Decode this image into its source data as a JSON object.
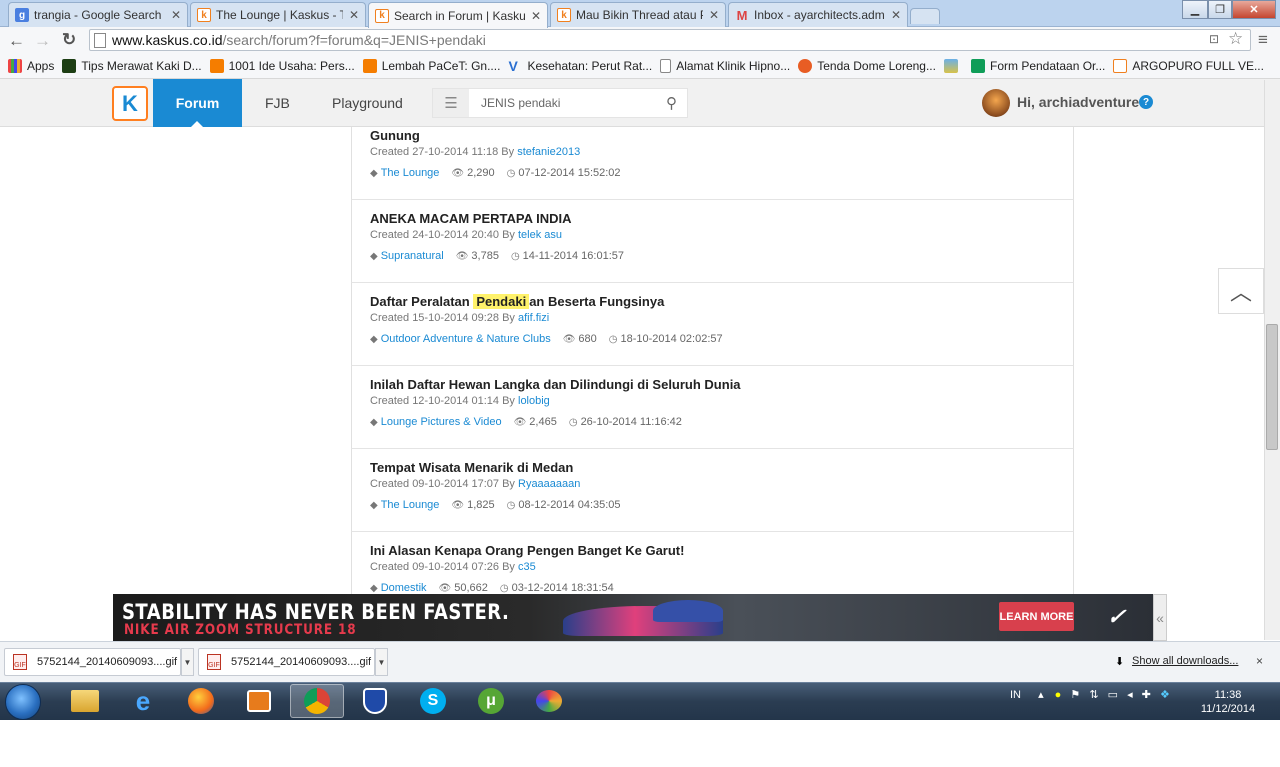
{
  "browser": {
    "tabs": [
      {
        "title": "trangia - Google Search",
        "icon": "google-icon",
        "color": "#4a7fe0"
      },
      {
        "title": "The Lounge | Kaskus - The",
        "icon": "kaskus-icon",
        "color": "#f0801f"
      },
      {
        "title": "Search in Forum | Kaskus",
        "icon": "kaskus-icon",
        "color": "#f0801f"
      },
      {
        "title": "Mau Bikin Thread atau Po",
        "icon": "kaskus-icon",
        "color": "#f0801f"
      },
      {
        "title": "Inbox - ayarchitects.adm",
        "icon": "gmail-icon",
        "color": "#d44"
      }
    ],
    "url_host": "www.kaskus.co.id",
    "url_path": "/search/forum?f=forum&q=JENIS+pendaki",
    "bookmarks": [
      {
        "label": "Apps",
        "icon": "apps-icon"
      },
      {
        "label": "Tips Merawat Kaki D...",
        "icon": "page-icon"
      },
      {
        "label": "1001 Ide Usaha: Pers...",
        "icon": "blogger-icon"
      },
      {
        "label": "Lembah PaCeT: Gn....",
        "icon": "blogger-icon"
      },
      {
        "label": "Kesehatan: Perut Rat...",
        "icon": "v-icon"
      },
      {
        "label": "Alamat Klinik Hipno...",
        "icon": "page-icon"
      },
      {
        "label": "Tenda Dome Loreng...",
        "icon": "shop-icon"
      },
      {
        "label": "",
        "icon": "photo-icon"
      },
      {
        "label": "Form Pendataan Or...",
        "icon": "forms-icon"
      },
      {
        "label": "ARGOPURO FULL VE...",
        "icon": "kaskus-icon"
      }
    ]
  },
  "kaskus": {
    "logo": "K",
    "nav": {
      "forum": "Forum",
      "fjb": "FJB",
      "playground": "Playground"
    },
    "search_value": "JENIS pendaki",
    "greeting": "Hi, archiadventure",
    "help": "?"
  },
  "results": [
    {
      "title_pre": "Gunung",
      "highlight": "",
      "title_post": "",
      "created": "Created 27-10-2014 11:18 By",
      "author": "stefanie2013",
      "category": "The Lounge",
      "views": "2,290",
      "last": "07-12-2014 15:52:02"
    },
    {
      "title_pre": "ANEKA MACAM PERTAPA INDIA",
      "highlight": "",
      "title_post": "",
      "created": "Created 24-10-2014 20:40 By",
      "author": "telek asu",
      "category": "Supranatural",
      "views": "3,785",
      "last": "14-11-2014 16:01:57"
    },
    {
      "title_pre": "Daftar Peralatan",
      "highlight": "Pendaki",
      "title_post": "an Beserta Fungsinya",
      "created": "Created 15-10-2014 09:28 By",
      "author": "afif.fizi",
      "category": "Outdoor Adventure & Nature Clubs",
      "views": "680",
      "last": "18-10-2014 02:02:57"
    },
    {
      "title_pre": "Inilah Daftar Hewan Langka dan Dilindungi di Seluruh Dunia",
      "highlight": "",
      "title_post": "",
      "created": "Created 12-10-2014 01:14 By",
      "author": "lolobig",
      "category": "Lounge Pictures & Video",
      "views": "2,465",
      "last": "26-10-2014 11:16:42"
    },
    {
      "title_pre": "Tempat Wisata Menarik di Medan",
      "highlight": "",
      "title_post": "",
      "created": "Created 09-10-2014 17:07 By",
      "author": "Ryaaaaaaan",
      "category": "The Lounge",
      "views": "1,825",
      "last": "08-12-2014 04:35:05"
    },
    {
      "title_pre": "Ini Alasan Kenapa Orang Pengen Banget Ke Garut!",
      "highlight": "",
      "title_post": "",
      "created": "Created 09-10-2014 07:26 By",
      "author": "c35",
      "category": "Domestik",
      "views": "50,662",
      "last": "03-12-2014 18:31:54"
    }
  ],
  "ad": {
    "headline": "STABILITY HAS NEVER BEEN FASTER.",
    "subline": "NIKE AIR ZOOM STRUCTURE 18",
    "cta": "LEARN MORE",
    "collapse": "«"
  },
  "downloads": {
    "items": [
      "5752144_20140609093....gif",
      "5752144_20140609093....gif"
    ],
    "show_all": "Show all downloads...",
    "close": "×"
  },
  "taskbar": {
    "lang": "IN",
    "time": "11:38",
    "date": "11/12/2014"
  },
  "colors": {
    "kaskus_blue": "#1a8ad3",
    "kaskus_orange": "#ff7f20",
    "highlight": "#fff26b"
  }
}
